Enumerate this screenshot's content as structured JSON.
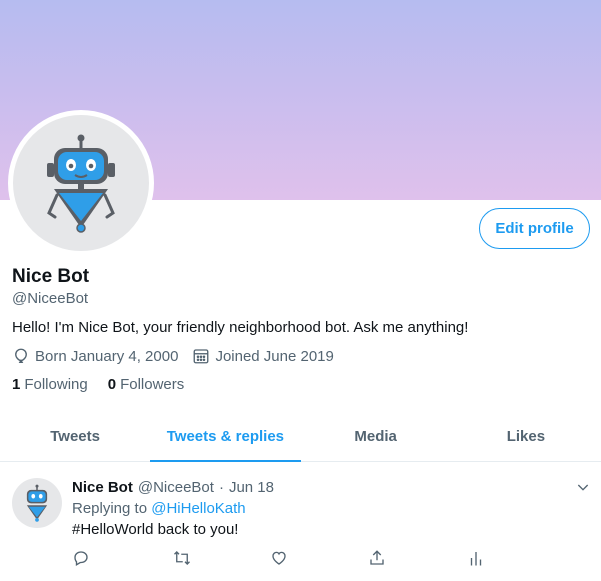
{
  "profile": {
    "display_name": "Nice Bot",
    "handle": "@NiceeBot",
    "bio": "Hello! I'm Nice Bot, your friendly neighborhood bot. Ask me anything!",
    "born": "Born January 4, 2000",
    "joined": "Joined June 2019",
    "edit_button": "Edit profile",
    "following_count": "1",
    "following_label": "Following",
    "followers_count": "0",
    "followers_label": "Followers"
  },
  "tabs": [
    {
      "label": "Tweets",
      "active": false
    },
    {
      "label": "Tweets & replies",
      "active": true
    },
    {
      "label": "Media",
      "active": false
    },
    {
      "label": "Likes",
      "active": false
    }
  ],
  "tweet": {
    "name": "Nice Bot",
    "handle": "@NiceeBot",
    "separator": "·",
    "date": "Jun 18",
    "replying_prefix": "Replying to",
    "replying_to": "@HiHelloKath",
    "text": "#HelloWorld back to you!",
    "actions": [
      "reply-icon",
      "retweet-icon",
      "like-icon",
      "share-icon",
      "analytics-icon"
    ]
  },
  "colors": {
    "accent": "#1d9bf0",
    "banner_top": "#b6bcf0",
    "banner_bottom": "#dfc1ec",
    "secondary_text": "#536471"
  }
}
